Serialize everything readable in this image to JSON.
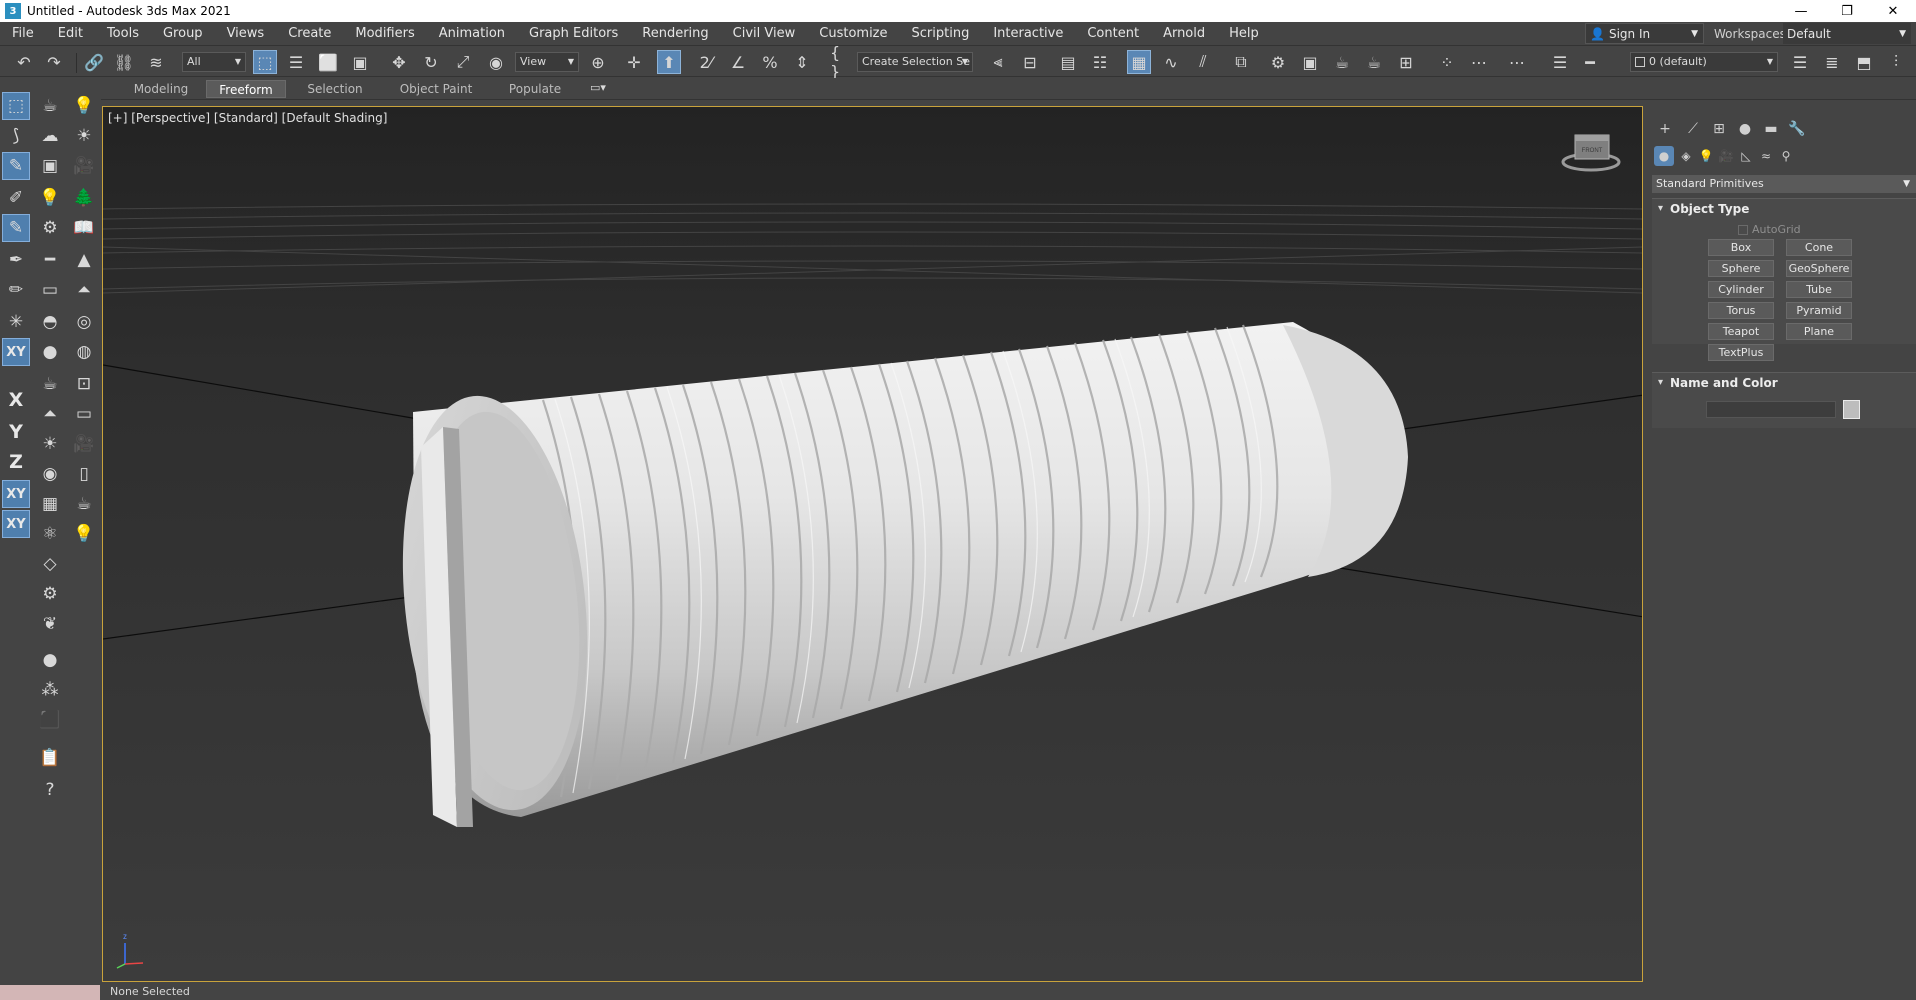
{
  "window": {
    "title": "Untitled - Autodesk 3ds Max 2021",
    "app_icon_glyph": "3"
  },
  "menubar": {
    "items": [
      "File",
      "Edit",
      "Tools",
      "Group",
      "Views",
      "Create",
      "Modifiers",
      "Animation",
      "Graph Editors",
      "Rendering",
      "Civil View",
      "Customize",
      "Scripting",
      "Interactive",
      "Content",
      "Arnold",
      "Help"
    ],
    "sign_in": "Sign In",
    "workspaces_label": "Workspaces:",
    "workspace_value": "Default"
  },
  "toolbar": {
    "selection_filter": "All",
    "reference_coord": "View",
    "named_selection": "Create Selection Se",
    "layer": "0 (default)"
  },
  "ribbon": {
    "tabs": [
      "Modeling",
      "Freeform",
      "Selection",
      "Object Paint",
      "Populate"
    ],
    "active_tab": "Freeform"
  },
  "viewport": {
    "label": "[+] [Perspective] [Standard] [Default Shading]",
    "viewcube_face": "FRONT",
    "border_color": "#c9a33c",
    "background": "#2b2b2b"
  },
  "command_panel": {
    "category": "Standard Primitives",
    "object_type": {
      "title": "Object Type",
      "autogrid": "AutoGrid",
      "buttons": [
        "Box",
        "Cone",
        "Sphere",
        "GeoSphere",
        "Cylinder",
        "Tube",
        "Torus",
        "Pyramid",
        "Teapot",
        "Plane",
        "TextPlus"
      ]
    },
    "name_and_color": {
      "title": "Name and Color",
      "swatch_color": "#bdbdbd"
    }
  },
  "statusbar": {
    "text": "None Selected"
  },
  "colors": {
    "accent": "#5a87b5",
    "viewport_border": "#c9a33c"
  }
}
